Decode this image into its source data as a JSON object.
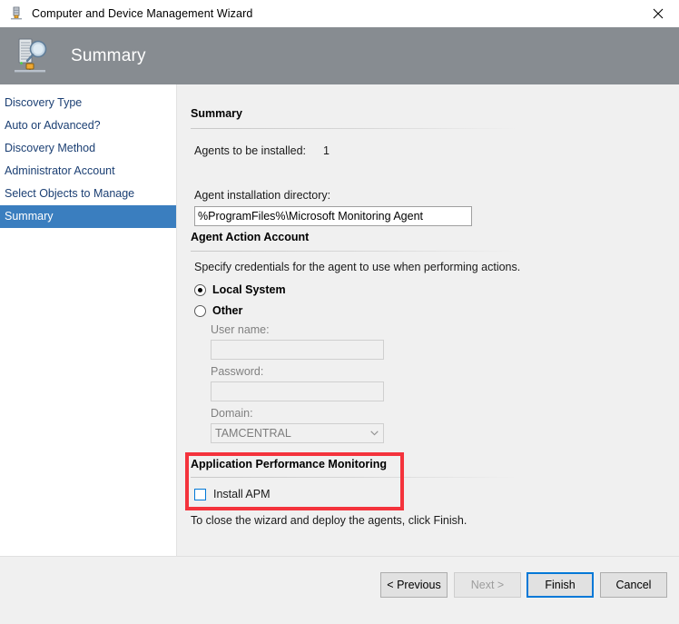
{
  "window": {
    "title": "Computer and Device Management Wizard",
    "icon": "server-icon",
    "close_label": "✕"
  },
  "header": {
    "title": "Summary",
    "icon": "discovery-server-magnifier-icon",
    "background": "#878c91"
  },
  "sidebar": {
    "selected_color": "#3a7ebf",
    "items": [
      {
        "label": "Discovery Type",
        "selected": false
      },
      {
        "label": "Auto or Advanced?",
        "selected": false
      },
      {
        "label": "Discovery Method",
        "selected": false
      },
      {
        "label": "Administrator Account",
        "selected": false
      },
      {
        "label": "Select Objects to Manage",
        "selected": false
      },
      {
        "label": "Summary",
        "selected": true
      }
    ]
  },
  "main": {
    "summary_section": {
      "heading": "Summary",
      "agents_label": "Agents to be installed:",
      "agents_count": "1",
      "install_dir_label": "Agent installation directory:",
      "install_dir_value": "%ProgramFiles%\\Microsoft Monitoring Agent",
      "install_dir_placeholder": ""
    },
    "agent_account_section": {
      "heading": "Agent Action Account",
      "description": "Specify credentials for the agent to use when performing actions.",
      "option_local_system": "Local System",
      "option_other": "Other",
      "selected_option": "Local System",
      "username_label": "User name:",
      "username_value": "",
      "password_label": "Password:",
      "password_value": "",
      "domain_label": "Domain:",
      "domain_value": "TAMCENTRAL"
    },
    "apm_section": {
      "heading": "Application Performance Monitoring",
      "install_apm_label": "Install APM",
      "install_apm_checked": false,
      "highlight_color": "#f4333c"
    },
    "footer_note": "To close the wizard and deploy the agents, click Finish."
  },
  "buttons": {
    "previous": "< Previous",
    "next": "Next >",
    "finish": "Finish",
    "cancel": "Cancel",
    "next_disabled": true,
    "finish_is_default": true
  }
}
